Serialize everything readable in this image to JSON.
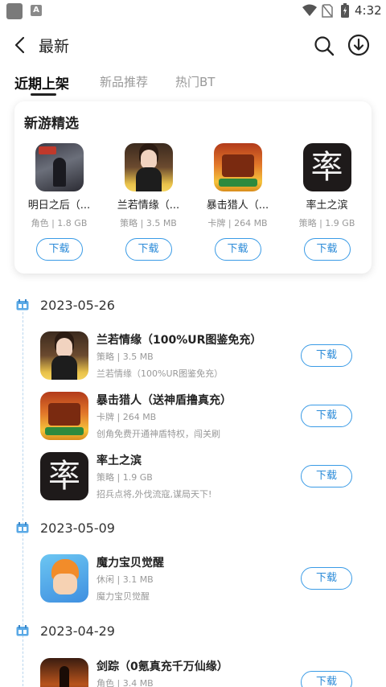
{
  "status_bar": {
    "time": "4:32",
    "small_icon_letter": "A"
  },
  "header": {
    "title": "最新"
  },
  "tabs": [
    {
      "label": "近期上架",
      "active": true
    },
    {
      "label": "新品推荐",
      "active": false
    },
    {
      "label": "热门BT",
      "active": false
    }
  ],
  "featured": {
    "title": "新游精选",
    "items": [
      {
        "name": "明日之后（...",
        "meta": "角色 | 1.8 GB",
        "button": "下载",
        "icon": "tomorrow-game-icon"
      },
      {
        "name": "兰若情缘（...",
        "meta": "策略 | 3.5 MB",
        "button": "下载",
        "icon": "lanruo-game-icon"
      },
      {
        "name": "暴击猎人（...",
        "meta": "卡牌 | 264 MB",
        "button": "下载",
        "icon": "baoji-game-icon"
      },
      {
        "name": "率土之滨",
        "meta": "策略 | 1.9 GB",
        "button": "下载",
        "icon": "shuaitu-game-icon",
        "icon_text": "率"
      }
    ]
  },
  "timeline": [
    {
      "date": "2023-05-26",
      "games": [
        {
          "name": "兰若情缘（100%UR图鉴免充）",
          "meta": "策略 | 3.5 MB",
          "desc": "兰若情缘（100%UR图鉴免充）",
          "button": "下载"
        },
        {
          "name": "暴击猎人（送神盾撸真充）",
          "meta": "卡牌 | 264 MB",
          "desc": "创角免费开通神盾特权，闯关刷",
          "button": "下载"
        },
        {
          "name": "率土之滨",
          "meta": "策略 | 1.9 GB",
          "desc": "招兵点将,外伐流寇,谋局天下!",
          "button": "下载",
          "icon_text": "率"
        }
      ]
    },
    {
      "date": "2023-05-09",
      "games": [
        {
          "name": "魔力宝贝觉醒",
          "meta": "休闲 | 3.1 MB",
          "desc": "魔力宝贝觉醒",
          "button": "下载"
        }
      ]
    },
    {
      "date": "2023-04-29",
      "games": [
        {
          "name": "剑踪（0氪真充千万仙缘）",
          "meta": "角色 | 3.4 MB",
          "button": "下载"
        }
      ]
    }
  ],
  "colors": {
    "accent": "#3a9be6",
    "text_primary": "#222222",
    "text_secondary": "#999999"
  }
}
